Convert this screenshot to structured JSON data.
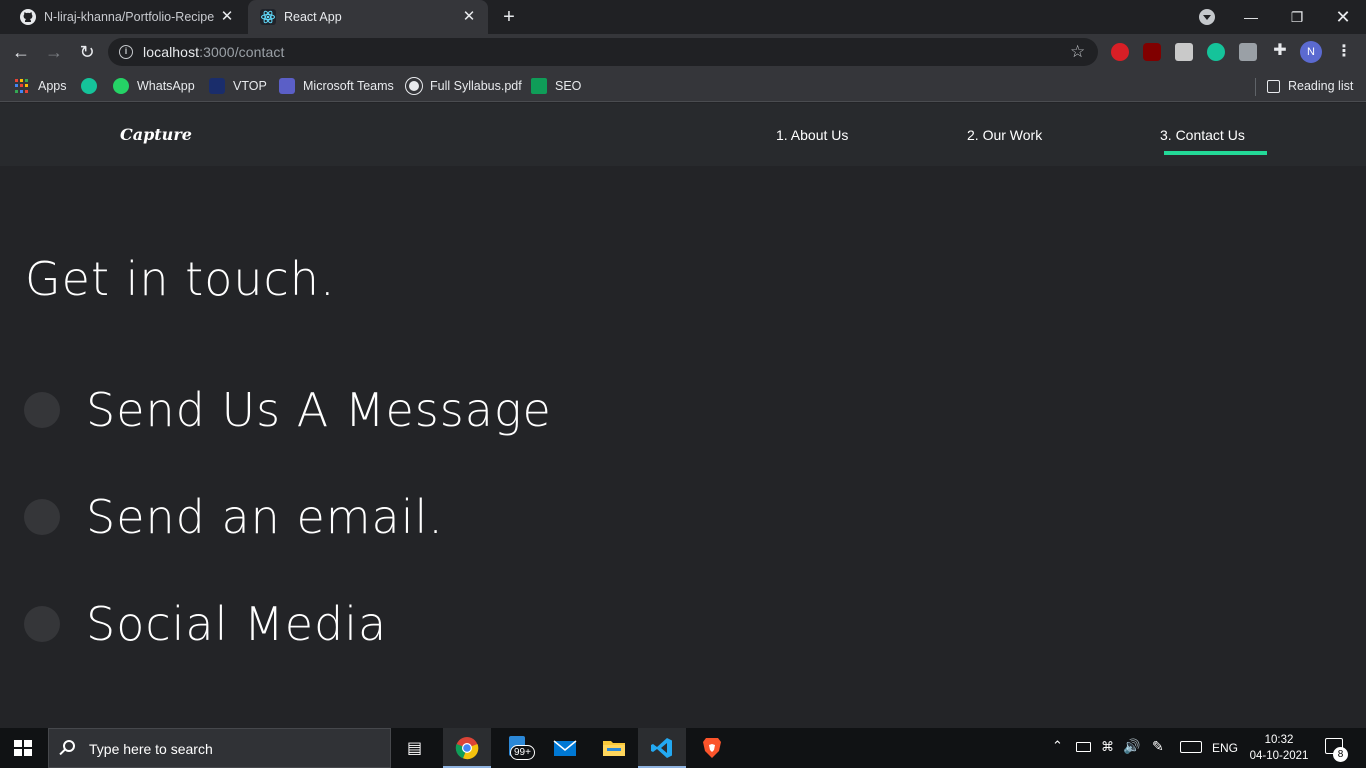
{
  "browser": {
    "tabs": [
      {
        "title": "N-liraj-khanna/Portfolio-Recipe-i",
        "favicon": "github-icon",
        "active": false
      },
      {
        "title": "React App",
        "favicon": "react-icon",
        "active": true
      }
    ],
    "url_host": "localhost",
    "url_path": ":3000/contact",
    "profile_initial": "N",
    "bookmarks": [
      {
        "label": "Apps",
        "icon": "apps-grid-icon"
      },
      {
        "label": "",
        "icon": "grammarly-icon"
      },
      {
        "label": "WhatsApp",
        "icon": "whatsapp-icon"
      },
      {
        "label": "VTOP",
        "icon": "vtop-icon"
      },
      {
        "label": "Microsoft Teams",
        "icon": "teams-icon"
      },
      {
        "label": "Full Syllabus.pdf",
        "icon": "globe-icon"
      },
      {
        "label": "SEO",
        "icon": "seo-icon"
      }
    ],
    "reading_list": "Reading list"
  },
  "site": {
    "logo": "Capture",
    "nav": [
      {
        "label": "1. About Us"
      },
      {
        "label": "2. Our Work"
      },
      {
        "label": "3. Contact Us",
        "active": true
      }
    ],
    "accent": "#23d997",
    "heading": "Get in touch.",
    "contact_options": [
      {
        "label": "Send Us A Message"
      },
      {
        "label": "Send an email."
      },
      {
        "label": "Social Media"
      }
    ]
  },
  "taskbar": {
    "search_placeholder": "Type here to search",
    "mail_badge": "99+",
    "language": "ENG",
    "time": "10:32",
    "date": "04-10-2021",
    "notification_count": "8"
  }
}
